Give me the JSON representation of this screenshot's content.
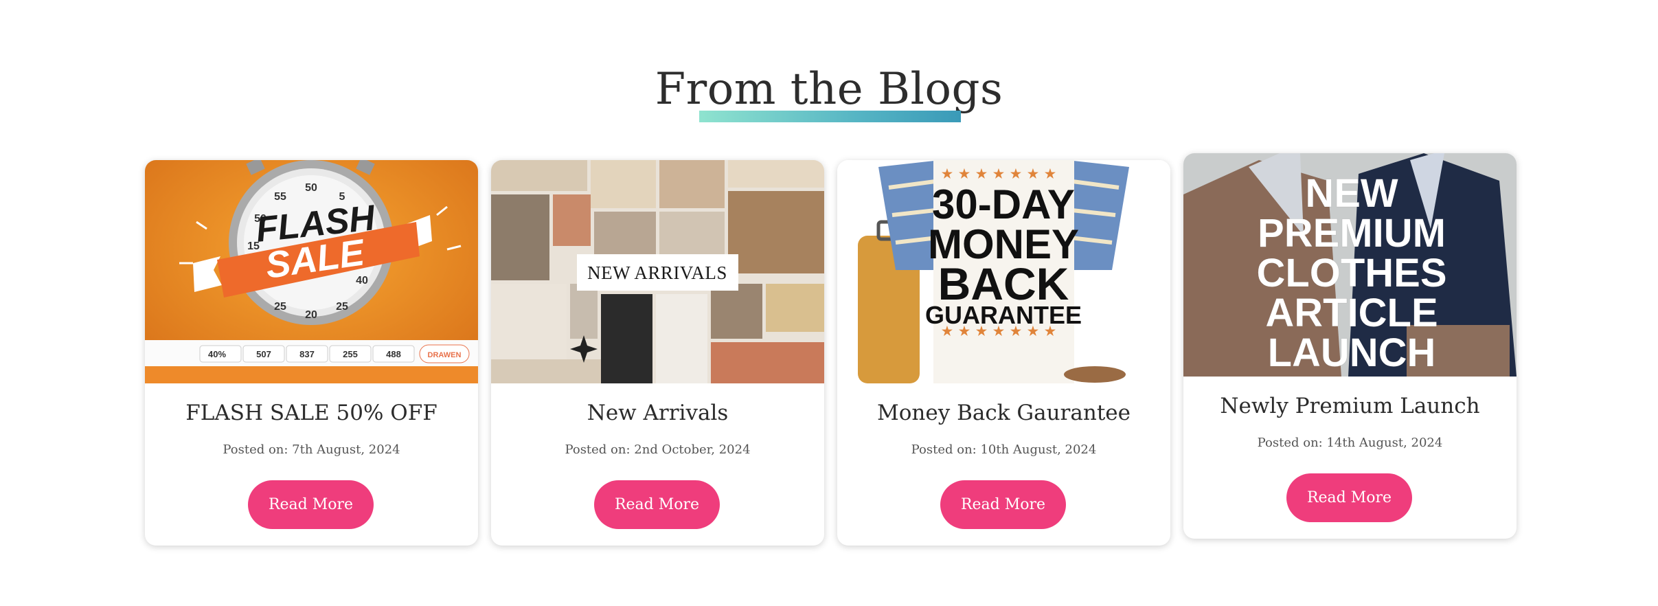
{
  "section": {
    "title": "From the Blogs"
  },
  "posts": [
    {
      "title": "FLASH SALE 50% OFF",
      "date": "Posted on: 7th August, 2024",
      "button": "Read More",
      "image": {
        "line1": "FLASH",
        "line2": "SALE",
        "dial": [
          "55",
          "50",
          "5",
          "50",
          "15",
          "40",
          "25",
          "20",
          "25"
        ],
        "strip": [
          "40%",
          "507",
          "837",
          "255",
          "488",
          "DRAWEN"
        ]
      }
    },
    {
      "title": "New Arrivals",
      "date": "Posted on: 2nd October, 2024",
      "button": "Read More",
      "image": {
        "label": "NEW ARRIVALS"
      }
    },
    {
      "title": "Money Back Gaurantee",
      "date": "Posted on: 10th August, 2024",
      "button": "Read More",
      "image": {
        "lines": [
          "30-DAY",
          "MONEY",
          "BACK",
          "GUARANTEE"
        ]
      }
    },
    {
      "title": "Newly Premium Launch",
      "date": "Posted on: 14th August, 2024",
      "button": "Read More",
      "image": {
        "lines": [
          "NEW",
          "PREMIUM",
          "CLOTHES",
          "ARTICLE",
          "LAUNCH"
        ]
      }
    }
  ],
  "colors": {
    "button": "#ef3d7c",
    "underline_start": "#8fe3cf",
    "underline_end": "#3a9ab8"
  }
}
